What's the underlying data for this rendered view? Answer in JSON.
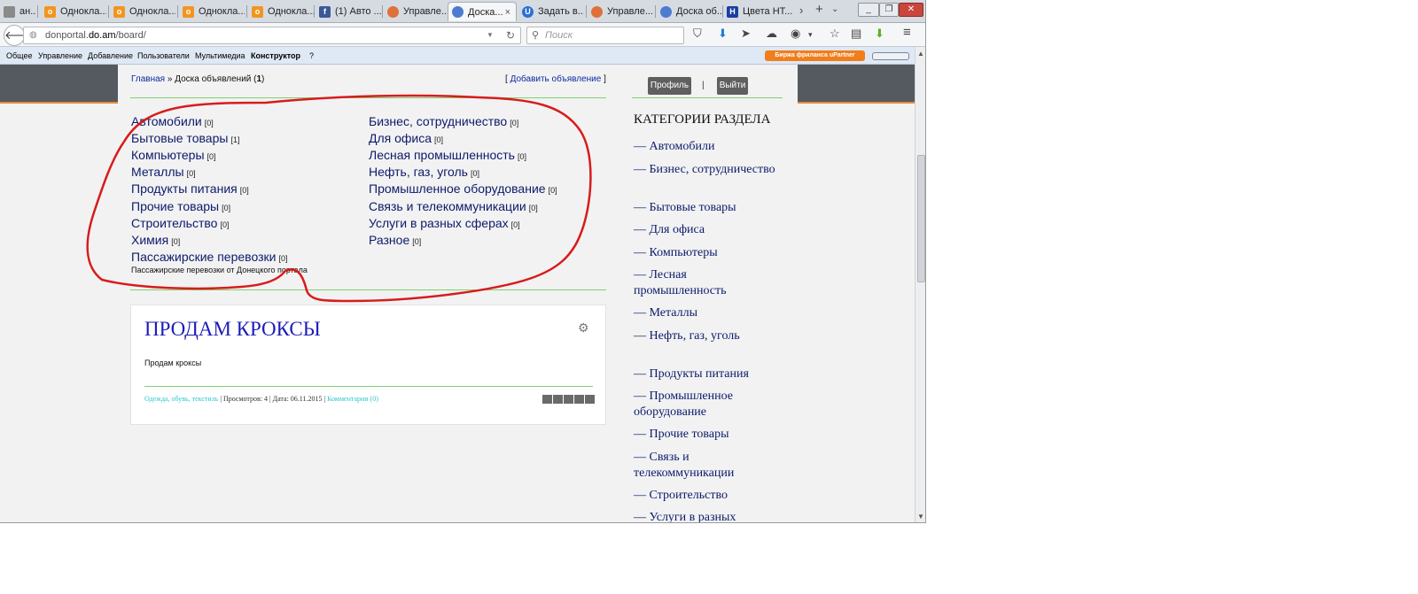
{
  "browser": {
    "tabs": [
      {
        "label": "ан...",
        "icon": "document-icon",
        "color": "#8a8a8a"
      },
      {
        "label": "Однокла...",
        "icon": "ok-icon",
        "color": "#f2951f"
      },
      {
        "label": "Однокла...",
        "icon": "ok-icon",
        "color": "#f2951f"
      },
      {
        "label": "Однокла...",
        "icon": "ok-icon",
        "color": "#f2951f"
      },
      {
        "label": "Однокла...",
        "icon": "ok-icon",
        "color": "#f2951f"
      },
      {
        "label": "(1) Авто ...",
        "icon": "facebook-icon",
        "color": "#3b5998"
      },
      {
        "label": "Управле...",
        "icon": "ucoz-icon",
        "color": "#e0703a"
      },
      {
        "label": "Доска...",
        "icon": "ucoz-icon",
        "color": "#4c7bd1"
      },
      {
        "label": "Задать в...",
        "icon": "question-icon",
        "color": "#2c70d6"
      },
      {
        "label": "Управле...",
        "icon": "ucoz-icon",
        "color": "#e0703a"
      },
      {
        "label": "Доска об...",
        "icon": "ucoz-icon",
        "color": "#4c7bd1"
      },
      {
        "label": "Цвета НТ...",
        "icon": "htmlcolors-icon",
        "color": "#1b3fa0"
      }
    ],
    "active_tab_close": "×",
    "tab_scroll": "›",
    "new_tab": "+",
    "tab_list": "⌄",
    "window_buttons": [
      "_",
      "❐",
      "✕"
    ],
    "url_host_prefix": "donportal.",
    "url_host_main": "do.am",
    "url_path": "/board/",
    "search_placeholder": "Поиск"
  },
  "admin_bar": {
    "items": [
      "Общее",
      "Управление",
      "Добавление",
      "Пользователи",
      "Мультимедиа",
      "Конструктор",
      "?"
    ],
    "freelance": "Биржа фриланса uPartner"
  },
  "breadcrumb": {
    "home": "Главная",
    "sep": "»",
    "current": "Доска объявлений (",
    "count": "1",
    "close": ")"
  },
  "add_ad": {
    "open": "[",
    "label": "Добавить объявление",
    "close": "]"
  },
  "categories_left": [
    {
      "name": "Автомобили",
      "count": "[0]"
    },
    {
      "name": "Бытовые товары",
      "count": "[1]"
    },
    {
      "name": "Компьютеры",
      "count": "[0]"
    },
    {
      "name": "Металлы",
      "count": "[0]"
    },
    {
      "name": "Продукты питания",
      "count": "[0]"
    },
    {
      "name": "Прочие товары",
      "count": "[0]"
    },
    {
      "name": "Строительство",
      "count": "[0]"
    },
    {
      "name": "Химия",
      "count": "[0]"
    },
    {
      "name": "Пассажирские перевозки",
      "count": "[0]"
    }
  ],
  "categories_right": [
    {
      "name": "Бизнес, сотрудничество",
      "count": "[0]"
    },
    {
      "name": "Для офиса",
      "count": "[0]"
    },
    {
      "name": "Лесная промышленность",
      "count": "[0]"
    },
    {
      "name": "Нефть, газ, уголь",
      "count": "[0]"
    },
    {
      "name": "Промышленное оборудование",
      "count": "[0]"
    },
    {
      "name": "Связь и телекоммуникации",
      "count": "[0]"
    },
    {
      "name": "Услуги в разных сферах",
      "count": "[0]"
    },
    {
      "name": "Разное",
      "count": "[0]"
    }
  ],
  "category_desc": "Пассажирские перевозки от Донецкого портала",
  "post": {
    "title": "ПРОДАМ КРОКСЫ",
    "text": "Продам кроксы",
    "category": "Одежда, обувь, текстиль",
    "views": "| Просмотров: 4 | Дата: 06.11.2015 |",
    "comments": "Комментарии (0)",
    "rating_stars": 5
  },
  "sidebar": {
    "profile": "Профиль",
    "sep": "|",
    "logout": "Выйти",
    "heading": "КАТЕГОРИИ РАЗДЕЛА",
    "items": [
      "— Автомобили",
      "— Бизнес, сотрудничество",
      "— Бытовые товары",
      "— Для офиса",
      "— Компьютеры",
      "— Лесная промышленность",
      "— Металлы",
      "— Нефть, газ, уголь",
      "— Продукты питания",
      "— Промышленное оборудование",
      "— Прочие товары",
      "— Связь и телекоммуникации",
      "— Строительство",
      "— Услуги в разных сферах"
    ]
  },
  "colors": {
    "header_band": "#555a60",
    "accent_orange": "#e58b3c",
    "link_blue": "#0d1a6b",
    "title_blue": "#1d1db8",
    "divider_green": "#7fd06f",
    "annotation_red": "#d81b1b"
  }
}
